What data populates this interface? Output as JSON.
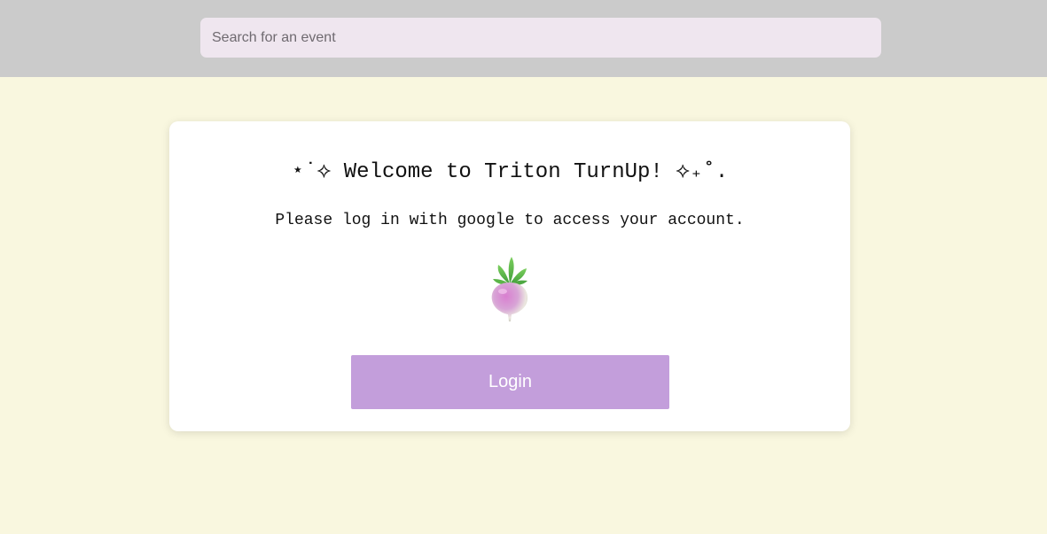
{
  "search": {
    "placeholder": "Search for an event",
    "value": ""
  },
  "card": {
    "title": "⋆˙⟡ Welcome to Triton TurnUp! ⟡₊˚.",
    "subtitle": "Please log in with google to access your account.",
    "logo_icon": "turnip-icon",
    "login_label": "Login"
  },
  "colors": {
    "page_background": "#f9f7df",
    "topbar_background": "#cbcbcb",
    "search_background": "#efe6ef",
    "card_background": "#ffffff",
    "login_button": "#c39edb"
  }
}
